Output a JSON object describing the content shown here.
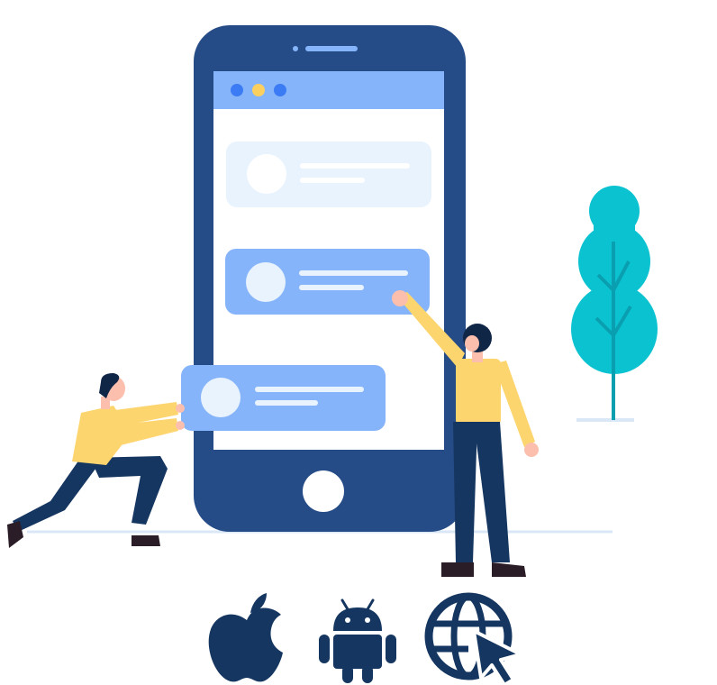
{
  "illustration": {
    "subject": "mobile-app-development",
    "colors": {
      "phone_body": "#264c87",
      "screen": "#ffffff",
      "topbar": "#86b4fb",
      "card_light": "#e9f3fe",
      "card_active": "#86b4fb",
      "avatar_on_light": "#ffffff",
      "avatar_on_active": "#e9f3fe",
      "dot_blue": "#3b7cf4",
      "dot_yellow": "#fccf61",
      "tree": "#0bc3d0",
      "tree_trunk": "#0a9fb0",
      "shirt": "#fdd56f",
      "pants": "#153660",
      "skin": "#fcbfad",
      "hair": "#0f2646",
      "shoes": "#2a1d27",
      "ground": "#d9e7f6",
      "platform_icons": "#153660"
    }
  },
  "platforms": [
    {
      "name": "apple-icon"
    },
    {
      "name": "android-icon"
    },
    {
      "name": "web-icon"
    }
  ]
}
